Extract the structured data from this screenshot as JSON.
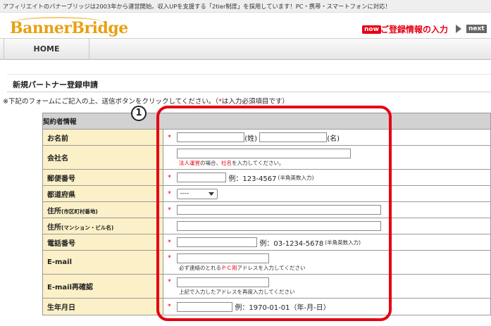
{
  "header": {
    "tagline": "アフィリエイトのバナーブリッジは2003年から運営開始。収入UPを支援する「2tier制度」を採用しています！PC・携帯・スマートフォンに対応！",
    "logo": "BannerBridge",
    "now_badge": "now",
    "now_text": "ご登録情報の入力",
    "next_badge": "next"
  },
  "nav": {
    "home": "HOME"
  },
  "page": {
    "title": "新規パートナー登録申請",
    "notice_pre": "※下記のフォームにご記入の上、送信ボタンをクリックしてください。（",
    "notice_req": "*",
    "notice_post": "は入力必須項目です）"
  },
  "annotation": {
    "number": "1"
  },
  "form": {
    "section": "契約者情報",
    "required_mark": "*",
    "rows": {
      "name": {
        "label": "お名前",
        "sei": "(姓)",
        "mei": "(名)"
      },
      "company": {
        "label": "会社名",
        "note_1": "法人運営",
        "note_2": "の場合、",
        "note_3": "社名",
        "note_4": "を入力してください。"
      },
      "zip": {
        "label": "郵便番号",
        "example": "例：123-4567",
        "hint": "(半角英数入力)"
      },
      "pref": {
        "label": "都道府県",
        "selected": "----"
      },
      "addr1": {
        "label": "住所",
        "label_small": "(市区町村番地)"
      },
      "addr2": {
        "label": "住所",
        "label_small": "(マンション・ビル名)"
      },
      "tel": {
        "label": "電話番号",
        "example": "例：03-1234-5678",
        "hint": "(半角英数入力)"
      },
      "email": {
        "label": "E-mail",
        "note_1": "必ず連絡のとれる",
        "note_2": "ＰＣ用",
        "note_3": "アドレスを入力してください"
      },
      "email2": {
        "label": "E-mail再確認",
        "note": "上記で入力したアドレスを再度入力してください"
      },
      "birth": {
        "label": "生年月日",
        "example": "例：1970-01-01（年-月-日）"
      }
    }
  },
  "colors": {
    "accent_red": "#e60012",
    "label_bg": "#fbf0c8",
    "logo_orange": "#e8a012"
  }
}
